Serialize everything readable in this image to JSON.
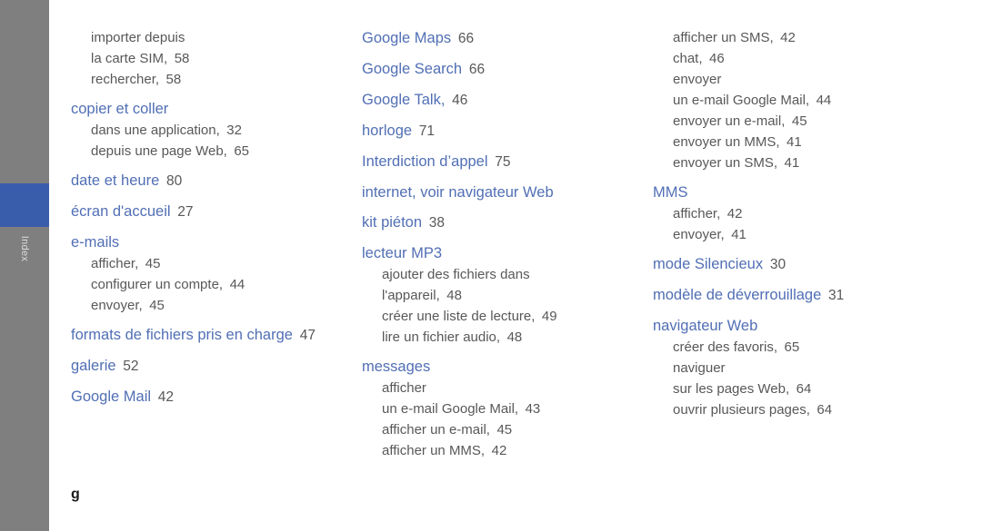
{
  "sidebar": {
    "tab_label": "Index",
    "tab_color": "#7f7f7f",
    "marker_color": "#3a5dab",
    "label_color": "#dcdcdc"
  },
  "page": {
    "folio": "g",
    "heading_color": "#516fb5",
    "body_color": "#58585a",
    "background": "#ffffff"
  },
  "columns": [
    {
      "id": "column-1",
      "entries": [
        {
          "type": "continuation",
          "subs": [
            {
              "label": "importer depuis",
              "page": ""
            },
            {
              "label": "la carte SIM,",
              "page": "58"
            },
            {
              "label": "rechercher,",
              "page": "58"
            }
          ]
        },
        {
          "type": "entry",
          "heading": "copier et coller",
          "page": "",
          "subs": [
            {
              "label": "dans une application,",
              "page": "32"
            },
            {
              "label": "depuis une page Web,",
              "page": "65"
            }
          ]
        },
        {
          "type": "entry",
          "heading": "date et heure",
          "page": "80",
          "subs": []
        },
        {
          "type": "entry",
          "heading": "écran d'accueil",
          "page": "27",
          "subs": []
        },
        {
          "type": "entry",
          "heading": "e-mails",
          "page": "",
          "subs": [
            {
              "label": "afficher,",
              "page": "45"
            },
            {
              "label": "configurer un compte,",
              "page": "44"
            },
            {
              "label": "envoyer,",
              "page": "45"
            }
          ]
        },
        {
          "type": "entry",
          "heading": "formats de fichiers pris en charge",
          "page": "47",
          "subs": []
        },
        {
          "type": "entry",
          "heading": "galerie",
          "page": "52",
          "subs": []
        },
        {
          "type": "entry",
          "heading": "Google Mail",
          "page": "42",
          "subs": []
        }
      ]
    },
    {
      "id": "column-2",
      "entries": [
        {
          "type": "entry",
          "heading": "Google Maps",
          "page": "66",
          "subs": []
        },
        {
          "type": "entry",
          "heading": "Google Search",
          "page": "66",
          "subs": []
        },
        {
          "type": "entry",
          "heading": "Google Talk,",
          "page": "46",
          "subs": []
        },
        {
          "type": "entry",
          "heading": "horloge",
          "page": "71",
          "subs": []
        },
        {
          "type": "entry",
          "heading": "Interdiction d’appel",
          "page": "75",
          "subs": []
        },
        {
          "type": "entry",
          "heading": "internet, voir navigateur Web",
          "page": "",
          "subs": []
        },
        {
          "type": "entry",
          "heading": "kit piéton",
          "page": "38",
          "subs": []
        },
        {
          "type": "entry",
          "heading": "lecteur MP3",
          "page": "",
          "subs": [
            {
              "label": "ajouter des fichiers dans",
              "page": ""
            },
            {
              "label": "l'appareil,",
              "page": "48"
            },
            {
              "label": "créer une liste de lecture,",
              "page": "49"
            },
            {
              "label": "lire un fichier audio,",
              "page": "48"
            }
          ]
        },
        {
          "type": "entry",
          "heading": "messages",
          "page": "",
          "subs": [
            {
              "label": "afficher",
              "page": ""
            },
            {
              "label": "un e-mail Google Mail,",
              "page": "43"
            },
            {
              "label": "afficher un e-mail,",
              "page": "45"
            },
            {
              "label": "afficher un MMS,",
              "page": "42"
            }
          ]
        }
      ]
    },
    {
      "id": "column-3",
      "entries": [
        {
          "type": "continuation",
          "subs": [
            {
              "label": "afficher un SMS,",
              "page": "42"
            },
            {
              "label": "chat,",
              "page": "46"
            },
            {
              "label": "envoyer",
              "page": ""
            },
            {
              "label": "un e-mail Google Mail,",
              "page": "44"
            },
            {
              "label": "envoyer un e-mail,",
              "page": "45"
            },
            {
              "label": "envoyer un MMS,",
              "page": "41"
            },
            {
              "label": "envoyer un SMS,",
              "page": "41"
            }
          ]
        },
        {
          "type": "entry",
          "heading": "MMS",
          "page": "",
          "subs": [
            {
              "label": "afficher,",
              "page": "42"
            },
            {
              "label": "envoyer,",
              "page": "41"
            }
          ]
        },
        {
          "type": "entry",
          "heading": "mode Silencieux",
          "page": "30",
          "subs": []
        },
        {
          "type": "entry",
          "heading": "modèle de déverrouillage",
          "page": "31",
          "subs": []
        },
        {
          "type": "entry",
          "heading": "navigateur Web",
          "page": "",
          "subs": [
            {
              "label": "créer des favoris,",
              "page": "65"
            },
            {
              "label": "naviguer",
              "page": ""
            },
            {
              "label": "sur les pages Web,",
              "page": "64"
            },
            {
              "label": "ouvrir plusieurs pages,",
              "page": "64"
            }
          ]
        }
      ]
    }
  ]
}
